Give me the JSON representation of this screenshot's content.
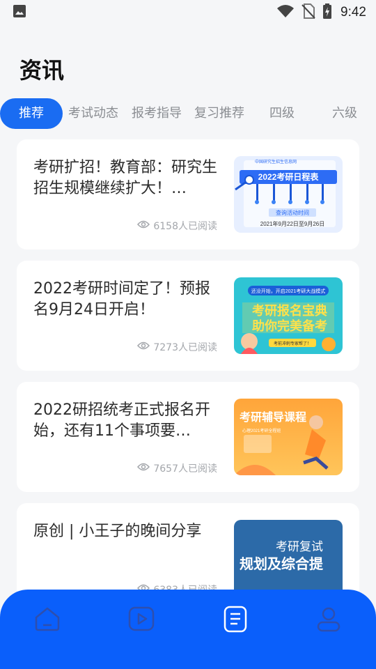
{
  "status_bar": {
    "time": "9:42",
    "icons": [
      "image-icon",
      "wifi-icon",
      "no-sim-icon",
      "battery-charging-icon"
    ]
  },
  "page": {
    "title": "资讯"
  },
  "tabs": [
    {
      "label": "推荐",
      "active": true
    },
    {
      "label": "考试动态",
      "active": false
    },
    {
      "label": "报考指导",
      "active": false
    },
    {
      "label": "复习推荐",
      "active": false
    },
    {
      "label": "四级",
      "active": false
    },
    {
      "label": "六级",
      "active": false
    }
  ],
  "articles": [
    {
      "title": "考研扩招！教育部：研究生招生规模继续扩大！…",
      "reads": "6158人已阅读",
      "thumb": {
        "site": "中国研究生招生信息网",
        "banner": "2022考研日程表",
        "tag": "查询活动时间",
        "date": "2021年9月22日至9月26日"
      }
    },
    {
      "title": "2022考研时间定了！预报名9月24日开启！",
      "reads": "7273人已阅读",
      "thumb": {
        "top": "还没开始，开启2021考研大战模式",
        "line1": "考研报名宝典",
        "line2": "助你完美备考",
        "bottom": "考前冲刺专家帮了！"
      }
    },
    {
      "title": "2022研招统考正式报名开始，还有11个事项要…",
      "reads": "7657人已阅读",
      "thumb": {
        "title": "考研辅导课程",
        "sub": "心理2021考研全程班"
      }
    },
    {
      "title": "原创 | 小王子的晚间分享",
      "reads": "6383人已阅读",
      "thumb": {
        "line1": "考研复试",
        "line2": "规划及综合提"
      }
    }
  ],
  "bottom_nav": [
    {
      "icon": "home-icon",
      "active": false
    },
    {
      "icon": "video-play-icon",
      "active": false
    },
    {
      "icon": "article-icon",
      "active": true
    },
    {
      "icon": "profile-icon",
      "active": false
    }
  ],
  "colors": {
    "accent": "#1a6cf2",
    "nav_bg": "#0a5ffb",
    "page_bg": "#f5f6f8"
  }
}
